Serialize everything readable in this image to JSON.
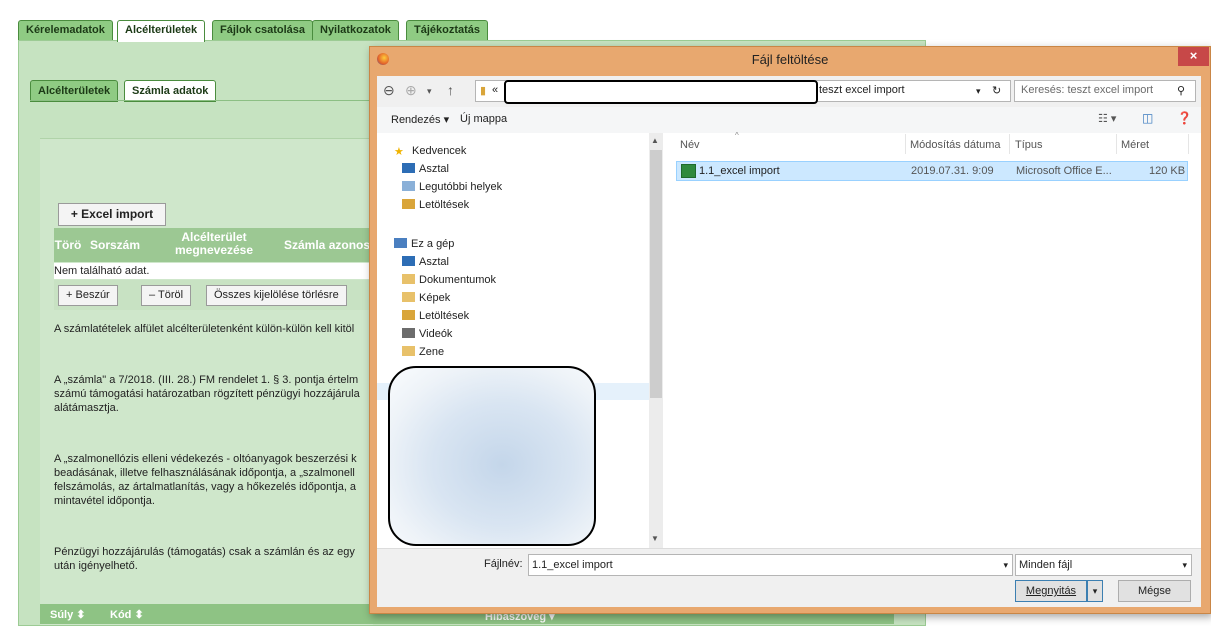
{
  "page": {
    "tabs": [
      "Kérelemadatok",
      "Alcélterületek",
      "Fájlok csatolása",
      "Nyilatkozatok",
      "Tájékoztatás"
    ],
    "active_tab": "Alcélterületek",
    "subtabs": [
      "Alcélterületek",
      "Számla adatok"
    ],
    "excel_import": "Excel import",
    "table_headers": {
      "toro": "Törö",
      "sorszam": "Sorszám",
      "alcelterulet": "Alcélterület megnevezése",
      "szamla": "Számla azonos"
    },
    "no_result": "Nem található adat.",
    "buttons": {
      "beszur": "Beszúr",
      "torol": "Töröl",
      "osszes": "Összes kijelölése törlésre"
    },
    "paragraphs": [
      [
        "A számlatételek alfület alcélterületenként külön-külön kell kitöl"
      ],
      [
        "A „számla\" a 7/2018. (III. 28.) FM rendelet 1. § 3. pontja értelm",
        "számú támogatási határozatban rögzített pénzügyi hozzájárula",
        "alátámasztja."
      ],
      [
        "A „szalmonellózis elleni védekezés - oltóanyagok beszerzési k",
        "beadásának, illetve felhasználásának időpontja, a „szalmonell",
        "felszámolás, az ártalmatlanítás, vagy a hőkezelés időpontja, a",
        "mintavétel időpontja."
      ],
      [
        "Pénzügyi hozzájárulás (támogatás) csak a számlán és az egy",
        "után igényelhető."
      ]
    ],
    "bottom_bar": {
      "suly": "Súly ⬍",
      "kod": "Kód ⬍",
      "hibaszoveg": "Hibaszöveg ▾"
    }
  },
  "dialog": {
    "title": "Fájl feltöltése",
    "close": "×",
    "address_prefix": "«",
    "address_folder": "teszt excel import",
    "search_placeholder": "Keresés: teszt excel import",
    "toolbar": {
      "rendezes": "Rendezés ▾",
      "uj_mappa": "Új mappa"
    },
    "nav": {
      "kedvencek": "Kedvencek",
      "favorites": [
        "Asztal",
        "Legutóbbi helyek",
        "Letöltések"
      ],
      "ez_a_gep": "Ez a gép",
      "pc_items": [
        "Asztal",
        "Dokumentumok",
        "Képek",
        "Letöltések",
        "Videók",
        "Zene"
      ]
    },
    "columns": {
      "nev": "Név",
      "modositas": "Módosítás dátuma",
      "tipus": "Típus",
      "meret": "Méret"
    },
    "files": [
      {
        "name": "1.1_excel import",
        "date": "2019.07.31. 9:09",
        "type": "Microsoft Office E...",
        "size": "120 KB"
      }
    ],
    "filename_label": "Fájlnév:",
    "filename_value": "1.1_excel import",
    "filter": "Minden fájl",
    "open_button": "Megnyitás",
    "cancel_button": "Mégse"
  },
  "colors": {
    "green_tab": "#8fcb83",
    "panel": "#c6e3c1",
    "dialog_frame": "#e8a86f",
    "close_red": "#c74848",
    "selection": "#cce8ff"
  }
}
